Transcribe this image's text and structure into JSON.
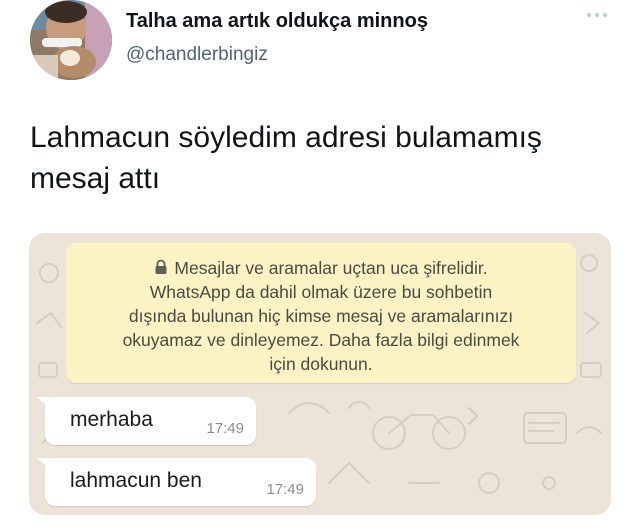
{
  "tweet": {
    "display_name": "Talha ama artık oldukça minnoş",
    "handle": "@chandlerbingiz",
    "text_line1": "Lahmacun söyledim adresi bulamamış",
    "text_line2": "mesaj attı",
    "more_icon": "more-dots-icon"
  },
  "screenshot": {
    "encryption_notice": {
      "icon": "lock-icon",
      "lines": [
        "Mesajlar ve aramalar uçtan uca şifrelidir.",
        "WhatsApp da dahil olmak üzere bu sohbetin",
        "dışında bulunan hiç kimse mesaj ve aramalarınızı",
        "okuyamaz ve dinleyemez. Daha fazla bilgi edinmek",
        "için dokunun."
      ]
    },
    "messages": [
      {
        "text": "merhaba",
        "time": "17:49"
      },
      {
        "text": "lahmacun ben",
        "time": "17:49"
      }
    ]
  },
  "colors": {
    "name": "#0f1419",
    "handle": "#536471",
    "chat_wallpaper": "#ece4d9",
    "notice_bg": "#fcf3c5",
    "bubble_bg": "#ffffff",
    "timestamp": "#8d8d8d"
  }
}
